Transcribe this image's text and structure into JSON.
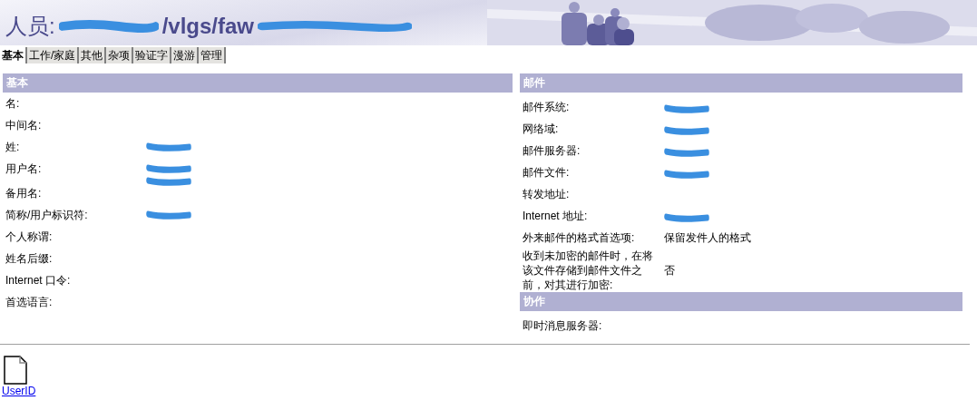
{
  "header": {
    "title": "人员:",
    "title_parts": [
      {
        "kind": "redacted"
      },
      {
        "kind": "text",
        "text": "/vlgs/faw"
      },
      {
        "kind": "redacted"
      }
    ]
  },
  "tabs": [
    {
      "label": "基本",
      "selected": true
    },
    {
      "label": "工作/家庭",
      "selected": false
    },
    {
      "label": "其他",
      "selected": false
    },
    {
      "label": "杂项",
      "selected": false
    },
    {
      "label": "验证字",
      "selected": false
    },
    {
      "label": "漫游",
      "selected": false
    },
    {
      "label": "管理",
      "selected": false
    }
  ],
  "left_sections": [
    {
      "title": "基本",
      "fields": [
        {
          "label": "名:"
        },
        {
          "label": "中间名:"
        },
        {
          "label": "姓:",
          "values": [
            {
              "kind": "redacted"
            }
          ]
        },
        {
          "label": "用户名:",
          "values": [
            {
              "kind": "redacted"
            },
            {
              "kind": "redacted"
            }
          ]
        },
        {
          "label": "备用名:"
        },
        {
          "label": "简称/用户标识符:",
          "values": [
            {
              "kind": "redacted"
            }
          ]
        },
        {
          "label": "个人称谓:"
        },
        {
          "label": "姓名后缀:"
        },
        {
          "label": "Internet 口令:"
        },
        {
          "label": "首选语言:"
        }
      ]
    }
  ],
  "right_sections": [
    {
      "title": "邮件",
      "fields": [
        {
          "label": "邮件系统:",
          "values": [
            {
              "kind": "redacted"
            }
          ]
        },
        {
          "label": "网络域:",
          "values": [
            {
              "kind": "redacted"
            }
          ]
        },
        {
          "label": "邮件服务器:",
          "values": [
            {
              "kind": "redacted"
            }
          ]
        },
        {
          "label": "邮件文件:",
          "values": [
            {
              "kind": "redacted"
            }
          ]
        },
        {
          "label": "转发地址:"
        },
        {
          "label": "Internet 地址:",
          "values": [
            {
              "kind": "redacted"
            }
          ]
        },
        {
          "label": "外来邮件的格式首选项:",
          "values": [
            {
              "kind": "text",
              "text": "保留发件人的格式"
            }
          ]
        },
        {
          "label": "收到未加密的邮件时，在将该文件存储到邮件文件之前，对其进行加密:",
          "values": [
            {
              "kind": "text",
              "text": "否"
            }
          ]
        }
      ]
    },
    {
      "title": "协作",
      "fields": [
        {
          "label": "即时消息服务器:"
        }
      ]
    }
  ],
  "attachment": {
    "name": "UserID"
  }
}
